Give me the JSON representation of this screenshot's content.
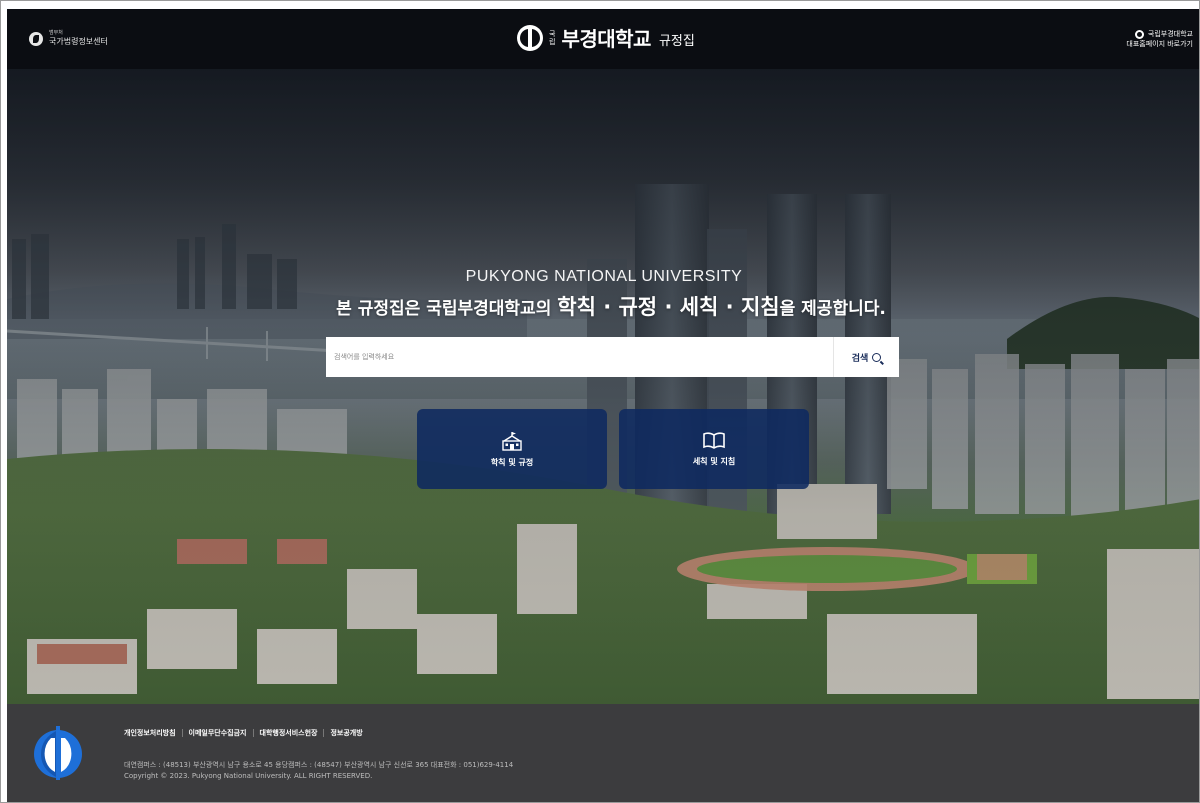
{
  "header": {
    "gov_link": {
      "small": "범부처",
      "main": "국가법령정보센터"
    },
    "brand": {
      "kuk_top": "국",
      "kuk_bottom": "립",
      "name": "부경대학교",
      "sub": "규정집"
    },
    "home_link": {
      "line1": "국립부경대학교",
      "line2": "대표홈페이지 바로가기"
    }
  },
  "hero": {
    "eyebrow": "PUKYONG NATIONAL UNIVERSITY",
    "title_pre": "본 규정집은 국립부경대학교의 ",
    "title_emph": "학칙 · 규정 · 세칙 · 지침",
    "title_post": "을 제공합니다."
  },
  "search": {
    "placeholder": "검색어를 입력하세요",
    "button_label": "검색"
  },
  "cards": [
    {
      "label": "학칙 및 규정",
      "icon": "school-building-icon"
    },
    {
      "label": "세칙 및 지침",
      "icon": "open-book-icon"
    }
  ],
  "footer": {
    "links": [
      "개인정보처리방침",
      "이메일무단수집금지",
      "대학행정서비스헌장",
      "정보공개방"
    ],
    "address": "대연캠퍼스 : (48513) 부산광역시 남구 용소로 45     용당캠퍼스 : (48547) 부산광역시 남구 신선로 365     대표전화 : 051)629-4114",
    "copyright": "Copyright © 2023. Pukyong National University. ALL RIGHT RESERVED."
  },
  "colors": {
    "header_bg": "#0b0d12",
    "card_bg": "#0e2960",
    "footer_bg": "#3c3c3e",
    "accent": "#1a2d5a"
  }
}
